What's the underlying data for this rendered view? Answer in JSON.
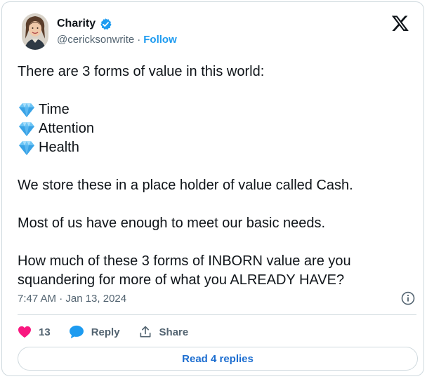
{
  "author": {
    "name": "Charity",
    "handle": "@cericksonwrite",
    "separator": "·",
    "follow_label": "Follow",
    "verified_color": "#1d9bf0"
  },
  "icons": {
    "verified": "verified-badge-icon",
    "brand": "x-logo-icon",
    "gem": "gem-stone-icon",
    "info": "info-icon",
    "like": "heart-icon",
    "reply": "speech-bubble-icon",
    "share": "share-upload-icon"
  },
  "tweet": {
    "intro": "There are 3 forms of value in this world:",
    "values": [
      "Time",
      "Attention",
      "Health"
    ],
    "line_cash": "We store these in a place holder of value called Cash.",
    "line_needs": "Most of us have enough to meet our basic needs.",
    "line_question": "How much of these 3 forms of INBORN value are you squandering for more of what you ALREADY HAVE?"
  },
  "timestamp": "7:47 AM · Jan 13, 2024",
  "actions": {
    "like_count": "13",
    "reply_label": "Reply",
    "share_label": "Share"
  },
  "read_replies_label": "Read 4 replies",
  "colors": {
    "accent": "#1d9bf0",
    "like": "#f91880",
    "text": "#0f1419",
    "muted": "#536471",
    "border": "#cfd9de"
  }
}
